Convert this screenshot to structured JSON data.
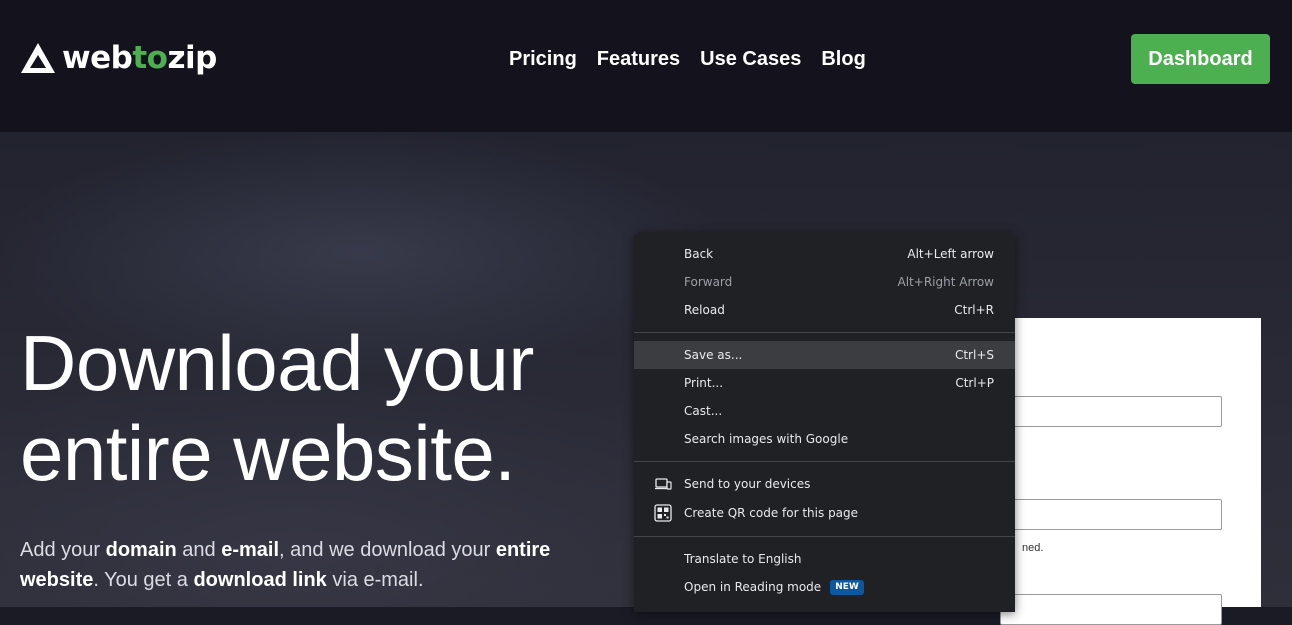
{
  "brand": {
    "name_part1": "web",
    "name_part2": "to",
    "name_part3": "zip",
    "accent_color": "#4caf50",
    "logo_icon": "triangle-logo-icon"
  },
  "nav": {
    "items": [
      "Pricing",
      "Features",
      "Use Cases",
      "Blog"
    ]
  },
  "header": {
    "dashboard_label": "Dashboard"
  },
  "hero": {
    "headline_line1": "Download your",
    "headline_line2": "entire website.",
    "sub_1": "Add your ",
    "sub_2": "domain",
    "sub_3": " and ",
    "sub_4": "e-mail",
    "sub_5": ", and we download your ",
    "sub_6": "entire website",
    "sub_7": ". You get a ",
    "sub_8": "download link",
    "sub_9": " via e-mail."
  },
  "form": {
    "partial_note": "ned."
  },
  "context_menu": {
    "items": [
      {
        "label": "Back",
        "shortcut": "Alt+Left arrow"
      },
      {
        "label": "Forward",
        "shortcut": "Alt+Right Arrow"
      },
      {
        "label": "Reload",
        "shortcut": "Ctrl+R"
      },
      {
        "label": "Save as...",
        "shortcut": "Ctrl+S"
      },
      {
        "label": "Print...",
        "shortcut": "Ctrl+P"
      },
      {
        "label": "Cast...",
        "shortcut": ""
      },
      {
        "label": "Search images with Google",
        "shortcut": ""
      },
      {
        "label": "Send to your devices",
        "shortcut": "",
        "icon": "devices-icon"
      },
      {
        "label": "Create QR code for this page",
        "shortcut": "",
        "icon": "qr-code-icon"
      },
      {
        "label": "Translate to English",
        "shortcut": ""
      },
      {
        "label": "Open in Reading mode",
        "shortcut": "",
        "badge": "NEW"
      }
    ]
  }
}
